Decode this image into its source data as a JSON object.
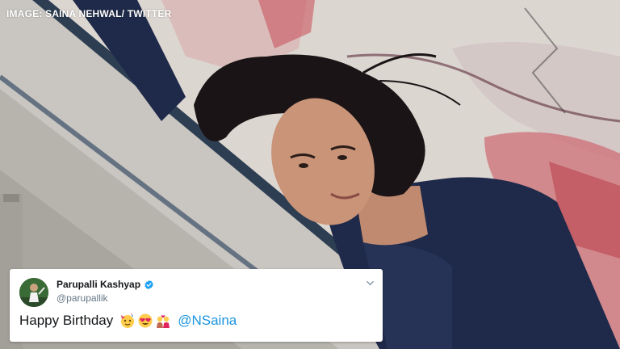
{
  "credit": "IMAGE: SAINA NEHWAL/ TWITTER",
  "tweet": {
    "author_name": "Parupalli Kashyap",
    "author_handle": "@parupallik",
    "text": "Happy Birthday",
    "mention": "@NSaina",
    "emojis": [
      "party-face-emoji",
      "heart-eyes-emoji",
      "couple-with-heart-emoji"
    ]
  },
  "colors": {
    "mention": "#1b95e0",
    "verified": "#1da1f2",
    "sweater": "#1f2a4a",
    "graffiti": "#c94a55"
  },
  "icons": {
    "verified": "verified-badge-icon",
    "menu": "chevron-down-icon"
  }
}
